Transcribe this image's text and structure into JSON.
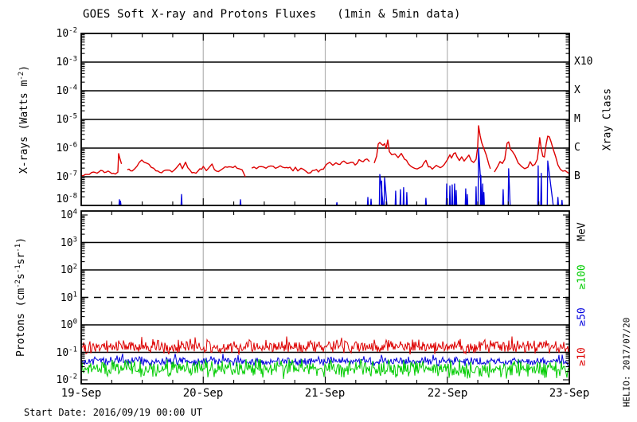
{
  "title": "GOES Soft X-ray and Protons Fluxes   (1min & 5min data)",
  "footer": {
    "start_date": "Start Date: 2016/09/19 00:00 UT"
  },
  "watermark": "HELIO: 2017/07/20",
  "colors": {
    "xray_long": "#dd0000",
    "xray_short": "#0000dd",
    "p10": "#dd0000",
    "p50": "#0000dd",
    "p100": "#00cc00",
    "grid": "#000000",
    "dayline": "#b3b3b3"
  },
  "chart_data": [
    {
      "type": "line",
      "panel": "xray",
      "ylabel_parts": [
        [
          "t",
          "X-rays (Watts m"
        ],
        [
          "s",
          "-2"
        ],
        [
          "t",
          ")"
        ]
      ],
      "right_axis_label": "Xray Class",
      "xray_class_labels": [
        {
          "label": "X10",
          "log": -3
        },
        {
          "label": "X",
          "log": -4
        },
        {
          "label": "M",
          "log": -5
        },
        {
          "label": "C",
          "log": -6
        },
        {
          "label": "B",
          "log": -7
        }
      ],
      "yticks_log": [
        -2,
        -3,
        -4,
        -5,
        -6,
        -7,
        -8
      ],
      "ylim_log": [
        -8,
        -2
      ],
      "xlim_days": [
        0,
        4
      ],
      "x_axis_labels": [
        "19-Sep",
        "20-Sep",
        "21-Sep",
        "22-Sep",
        "23-Sep"
      ],
      "gridlines_log": [
        -3,
        -4,
        -5,
        -6,
        -7
      ],
      "series": [
        {
          "name": "xray-long-1min",
          "color": "#dd0000",
          "segments": [
            [
              [
                0,
                -6.97
              ],
              [
                0.05,
                -6.93
              ],
              [
                0.1,
                -6.82
              ],
              [
                0.13,
                -6.9
              ],
              [
                0.16,
                -6.76
              ],
              [
                0.19,
                -6.87
              ],
              [
                0.22,
                -6.78
              ],
              [
                0.25,
                -6.9
              ],
              [
                0.28,
                -6.87
              ],
              [
                0.3,
                -6.84
              ],
              [
                0.307,
                -6.19
              ],
              [
                0.318,
                -6.4
              ],
              [
                0.33,
                -6.55
              ]
            ],
            [
              [
                0.378,
                -6.72
              ],
              [
                0.418,
                -6.78
              ],
              [
                0.457,
                -6.61
              ],
              [
                0.496,
                -6.42
              ],
              [
                0.535,
                -6.5
              ],
              [
                0.574,
                -6.67
              ],
              [
                0.613,
                -6.78
              ],
              [
                0.659,
                -6.83
              ],
              [
                0.705,
                -6.75
              ],
              [
                0.744,
                -6.81
              ],
              [
                0.783,
                -6.69
              ],
              [
                0.809,
                -6.56
              ],
              [
                0.829,
                -6.72
              ],
              [
                0.855,
                -6.47
              ],
              [
                0.874,
                -6.67
              ],
              [
                0.907,
                -6.83
              ],
              [
                0.94,
                -6.89
              ],
              [
                0.972,
                -6.75
              ],
              [
                1.0,
                -6.67
              ],
              [
                1.026,
                -6.78
              ],
              [
                1.052,
                -6.69
              ],
              [
                1.072,
                -6.53
              ],
              [
                1.091,
                -6.72
              ],
              [
                1.124,
                -6.81
              ],
              [
                1.163,
                -6.72
              ],
              [
                1.196,
                -6.64
              ],
              [
                1.228,
                -6.69
              ],
              [
                1.261,
                -6.64
              ],
              [
                1.293,
                -6.72
              ],
              [
                1.319,
                -6.78
              ],
              [
                1.345,
                -7.0
              ]
            ],
            [
              [
                1.397,
                -6.67
              ],
              [
                1.436,
                -6.72
              ],
              [
                1.475,
                -6.64
              ],
              [
                1.514,
                -6.69
              ],
              [
                1.553,
                -6.61
              ],
              [
                1.592,
                -6.69
              ],
              [
                1.631,
                -6.64
              ],
              [
                1.67,
                -6.72
              ],
              [
                1.71,
                -6.67
              ],
              [
                1.736,
                -6.78
              ],
              [
                1.755,
                -6.64
              ],
              [
                1.775,
                -6.81
              ],
              [
                1.801,
                -6.69
              ],
              [
                1.84,
                -6.83
              ],
              [
                1.879,
                -6.86
              ],
              [
                1.912,
                -6.75
              ],
              [
                1.944,
                -6.81
              ],
              [
                1.984,
                -6.72
              ],
              [
                2.01,
                -6.56
              ],
              [
                2.036,
                -6.47
              ],
              [
                2.062,
                -6.61
              ],
              [
                2.088,
                -6.5
              ],
              [
                2.121,
                -6.58
              ],
              [
                2.153,
                -6.44
              ],
              [
                2.179,
                -6.56
              ],
              [
                2.212,
                -6.47
              ],
              [
                2.245,
                -6.58
              ],
              [
                2.277,
                -6.42
              ],
              [
                2.31,
                -6.5
              ],
              [
                2.342,
                -6.36
              ],
              [
                2.362,
                -6.47
              ]
            ],
            [
              [
                2.401,
                -6.53
              ],
              [
                2.421,
                -6.28
              ],
              [
                2.434,
                -5.86
              ],
              [
                2.447,
                -5.78
              ],
              [
                2.46,
                -5.83
              ],
              [
                2.473,
                -5.92
              ],
              [
                2.486,
                -5.86
              ],
              [
                2.499,
                -6.0
              ],
              [
                2.512,
                -5.72
              ],
              [
                2.525,
                -6.11
              ],
              [
                2.545,
                -6.22
              ],
              [
                2.571,
                -6.17
              ],
              [
                2.597,
                -6.31
              ],
              [
                2.623,
                -6.22
              ],
              [
                2.649,
                -6.39
              ],
              [
                2.682,
                -6.53
              ],
              [
                2.714,
                -6.67
              ],
              [
                2.753,
                -6.72
              ],
              [
                2.792,
                -6.64
              ],
              [
                2.825,
                -6.42
              ],
              [
                2.845,
                -6.64
              ],
              [
                2.877,
                -6.72
              ],
              [
                2.91,
                -6.61
              ],
              [
                2.943,
                -6.69
              ],
              [
                2.975,
                -6.56
              ],
              [
                3.001,
                -6.39
              ],
              [
                3.021,
                -6.22
              ],
              [
                3.034,
                -6.36
              ],
              [
                3.053,
                -6.17
              ],
              [
                3.066,
                -6.14
              ],
              [
                3.079,
                -6.31
              ],
              [
                3.099,
                -6.42
              ],
              [
                3.118,
                -6.28
              ],
              [
                3.138,
                -6.44
              ],
              [
                3.158,
                -6.31
              ],
              [
                3.177,
                -6.25
              ],
              [
                3.197,
                -6.42
              ],
              [
                3.216,
                -6.5
              ],
              [
                3.236,
                -6.39
              ],
              [
                3.249,
                -5.97
              ],
              [
                3.256,
                -5.22
              ],
              [
                3.269,
                -5.56
              ],
              [
                3.282,
                -5.83
              ],
              [
                3.301,
                -6.06
              ],
              [
                3.321,
                -6.28
              ],
              [
                3.34,
                -6.56
              ],
              [
                3.353,
                -6.72
              ]
            ],
            [
              [
                3.386,
                -6.81
              ],
              [
                3.412,
                -6.67
              ],
              [
                3.432,
                -6.47
              ],
              [
                3.451,
                -6.56
              ],
              [
                3.471,
                -6.39
              ],
              [
                3.49,
                -5.86
              ],
              [
                3.503,
                -5.78
              ],
              [
                3.516,
                -6.0
              ],
              [
                3.536,
                -6.14
              ],
              [
                3.555,
                -6.28
              ],
              [
                3.581,
                -6.5
              ],
              [
                3.608,
                -6.64
              ],
              [
                3.634,
                -6.75
              ],
              [
                3.66,
                -6.67
              ],
              [
                3.679,
                -6.5
              ],
              [
                3.699,
                -6.64
              ],
              [
                3.718,
                -6.58
              ],
              [
                3.738,
                -6.39
              ],
              [
                3.751,
                -5.94
              ],
              [
                3.757,
                -5.64
              ],
              [
                3.77,
                -6.0
              ],
              [
                3.783,
                -6.25
              ],
              [
                3.796,
                -6.31
              ],
              [
                3.81,
                -5.86
              ],
              [
                3.823,
                -5.56
              ],
              [
                3.836,
                -5.61
              ],
              [
                3.849,
                -5.78
              ],
              [
                3.868,
                -6.06
              ],
              [
                3.888,
                -6.33
              ],
              [
                3.907,
                -6.61
              ],
              [
                3.927,
                -6.75
              ],
              [
                3.947,
                -6.83
              ],
              [
                3.966,
                -6.81
              ],
              [
                3.986,
                -6.86
              ],
              [
                4.0,
                -6.89
              ]
            ]
          ]
        },
        {
          "name": "xray-short-1min",
          "color": "#0000dd",
          "baseline_log": -8,
          "spikes": [
            [
              0.313,
              -7.8
            ],
            [
              0.322,
              -7.85
            ],
            [
              0.822,
              -7.62
            ],
            [
              1.305,
              -7.8
            ],
            [
              2.095,
              -7.9
            ],
            [
              2.349,
              -7.72
            ],
            [
              2.375,
              -7.78
            ],
            [
              2.447,
              -6.92,
              0.028
            ],
            [
              2.462,
              -7.15
            ],
            [
              2.486,
              -7.03,
              0.02
            ],
            [
              2.577,
              -7.5
            ],
            [
              2.616,
              -7.45
            ],
            [
              2.642,
              -7.38
            ],
            [
              2.668,
              -7.55
            ],
            [
              2.825,
              -7.75
            ],
            [
              2.995,
              -7.25
            ],
            [
              3.021,
              -7.32
            ],
            [
              3.04,
              -7.28
            ],
            [
              3.06,
              -7.25
            ],
            [
              3.073,
              -7.48
            ],
            [
              3.151,
              -7.42
            ],
            [
              3.164,
              -7.62
            ],
            [
              3.236,
              -7.35
            ],
            [
              3.256,
              -6.02,
              0.03
            ],
            [
              3.275,
              -6.95
            ],
            [
              3.29,
              -7.25
            ],
            [
              3.3,
              -7.55
            ],
            [
              3.458,
              -7.45
            ],
            [
              3.503,
              -6.72,
              0.012
            ],
            [
              3.745,
              -6.62
            ],
            [
              3.77,
              -6.88
            ],
            [
              3.823,
              -6.45,
              0.045
            ],
            [
              3.907,
              -7.72
            ],
            [
              3.94,
              -7.82
            ]
          ]
        }
      ]
    },
    {
      "type": "line",
      "panel": "protons",
      "ylabel_parts": [
        [
          "t",
          "Protons (cm"
        ],
        [
          "s",
          "-2"
        ],
        [
          "t",
          "s"
        ],
        [
          "s",
          "-1"
        ],
        [
          "t",
          "sr"
        ],
        [
          "s",
          "-1"
        ],
        [
          "t",
          ")"
        ]
      ],
      "right_labels": [
        {
          "text": "MeV",
          "color": "#000000",
          "log": 3.4
        },
        {
          "text": "≥100",
          "color": "#00cc00",
          "log": 1.75
        },
        {
          "text": "≥50",
          "color": "#0000dd",
          "log": 0.3
        },
        {
          "text": "≥10",
          "color": "#dd0000",
          "log": -1.15
        }
      ],
      "yticks_log": [
        4,
        3,
        2,
        1,
        0,
        -1,
        -2
      ],
      "ylim_log": [
        -2,
        4
      ],
      "xlim_days": [
        0,
        4
      ],
      "x_axis_labels": [
        "19-Sep",
        "20-Sep",
        "21-Sep",
        "22-Sep",
        "23-Sep"
      ],
      "gridlines_log": [
        3,
        2,
        0,
        -1
      ],
      "threshold_dashed_log": 1,
      "series": [
        {
          "name": "protons-ge10MeV",
          "color": "#dd0000",
          "base_log": -0.8,
          "noise_log": 0.3,
          "max_log": -0.42,
          "min_log": -1.15,
          "seed": 101
        },
        {
          "name": "protons-ge50MeV",
          "color": "#0000dd",
          "base_log": -1.33,
          "noise_log": 0.18,
          "max_log": -1.05,
          "min_log": -1.6,
          "seed": 202
        },
        {
          "name": "protons-ge100MeV",
          "color": "#00cc00",
          "base_log": -1.62,
          "noise_log": 0.36,
          "max_log": -1.25,
          "min_log": -1.98,
          "seed": 303
        }
      ]
    }
  ]
}
